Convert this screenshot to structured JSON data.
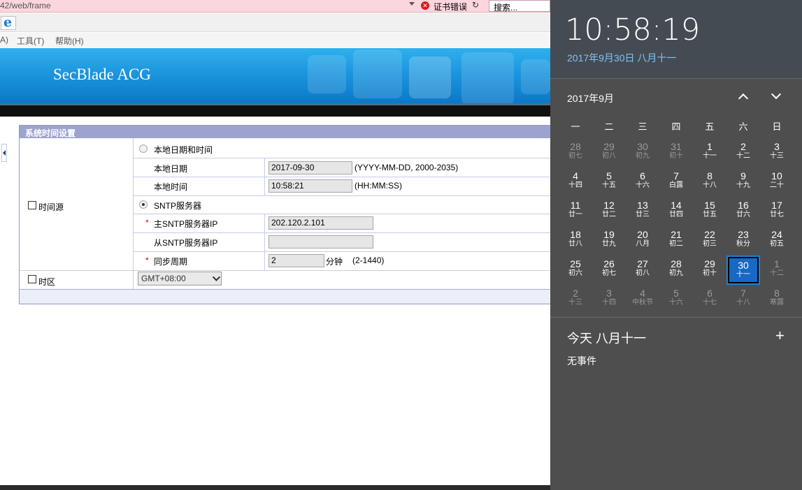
{
  "browser": {
    "url_fragment": "42/web/frame",
    "cert_error": "证书错误",
    "search_placeholder": "搜索...",
    "menu": [
      "A)",
      "工具(T)",
      "帮助(H)"
    ]
  },
  "app": {
    "title": "SecBlade ACG"
  },
  "panel": {
    "title": "系统时间设置",
    "time_source_label": "时间源",
    "local_option": "本地日期和时间",
    "local_date_label": "本地日期",
    "local_date_value": "2017-09-30",
    "local_date_hint": "(YYYY-MM-DD, 2000-2035)",
    "local_time_label": "本地时间",
    "local_time_value": "10:58:21",
    "local_time_hint": "(HH:MM:SS)",
    "sntp_option": "SNTP服务器",
    "required_mark": "*",
    "primary_ip_label": "主SNTP服务器IP",
    "primary_ip_value": "202.120.2.101",
    "secondary_ip_label": "从SNTP服务器IP",
    "secondary_ip_value": "",
    "sync_label": "同步周期",
    "sync_value": "2",
    "sync_unit": "分钟",
    "sync_hint": "(2-1440)",
    "timezone_label": "时区",
    "timezone_value": "GMT+08:00"
  },
  "calendar": {
    "clock": "10:58:19",
    "full_date": "2017年9月30日 八月十一",
    "month_label": "2017年9月",
    "weekdays": [
      "一",
      "二",
      "三",
      "四",
      "五",
      "六",
      "日"
    ],
    "weeks": [
      [
        {
          "d": "28",
          "l": "初七",
          "cur": false
        },
        {
          "d": "29",
          "l": "初八",
          "cur": false
        },
        {
          "d": "30",
          "l": "初九",
          "cur": false
        },
        {
          "d": "31",
          "l": "初十",
          "cur": false
        },
        {
          "d": "1",
          "l": "十一",
          "cur": true
        },
        {
          "d": "2",
          "l": "十二",
          "cur": true
        },
        {
          "d": "3",
          "l": "十三",
          "cur": true
        }
      ],
      [
        {
          "d": "4",
          "l": "十四",
          "cur": true
        },
        {
          "d": "5",
          "l": "十五",
          "cur": true
        },
        {
          "d": "6",
          "l": "十六",
          "cur": true
        },
        {
          "d": "7",
          "l": "白露",
          "cur": true
        },
        {
          "d": "8",
          "l": "十八",
          "cur": true
        },
        {
          "d": "9",
          "l": "十九",
          "cur": true
        },
        {
          "d": "10",
          "l": "二十",
          "cur": true
        }
      ],
      [
        {
          "d": "11",
          "l": "廿一",
          "cur": true
        },
        {
          "d": "12",
          "l": "廿二",
          "cur": true
        },
        {
          "d": "13",
          "l": "廿三",
          "cur": true
        },
        {
          "d": "14",
          "l": "廿四",
          "cur": true
        },
        {
          "d": "15",
          "l": "廿五",
          "cur": true
        },
        {
          "d": "16",
          "l": "廿六",
          "cur": true
        },
        {
          "d": "17",
          "l": "廿七",
          "cur": true
        }
      ],
      [
        {
          "d": "18",
          "l": "廿八",
          "cur": true
        },
        {
          "d": "19",
          "l": "廿九",
          "cur": true
        },
        {
          "d": "20",
          "l": "八月",
          "cur": true
        },
        {
          "d": "21",
          "l": "初二",
          "cur": true
        },
        {
          "d": "22",
          "l": "初三",
          "cur": true
        },
        {
          "d": "23",
          "l": "秋分",
          "cur": true
        },
        {
          "d": "24",
          "l": "初五",
          "cur": true
        }
      ],
      [
        {
          "d": "25",
          "l": "初六",
          "cur": true
        },
        {
          "d": "26",
          "l": "初七",
          "cur": true
        },
        {
          "d": "27",
          "l": "初八",
          "cur": true
        },
        {
          "d": "28",
          "l": "初九",
          "cur": true
        },
        {
          "d": "29",
          "l": "初十",
          "cur": true
        },
        {
          "d": "30",
          "l": "十一",
          "cur": true,
          "today": true
        },
        {
          "d": "1",
          "l": "十二",
          "cur": false
        }
      ],
      [
        {
          "d": "2",
          "l": "十三",
          "cur": false
        },
        {
          "d": "3",
          "l": "十四",
          "cur": false
        },
        {
          "d": "4",
          "l": "中秋节",
          "cur": false
        },
        {
          "d": "5",
          "l": "十六",
          "cur": false
        },
        {
          "d": "6",
          "l": "十七",
          "cur": false
        },
        {
          "d": "7",
          "l": "十八",
          "cur": false
        },
        {
          "d": "8",
          "l": "寒露",
          "cur": false
        }
      ]
    ],
    "today_heading": "今天 八月十一",
    "add_label": "+",
    "no_events": "无事件"
  }
}
